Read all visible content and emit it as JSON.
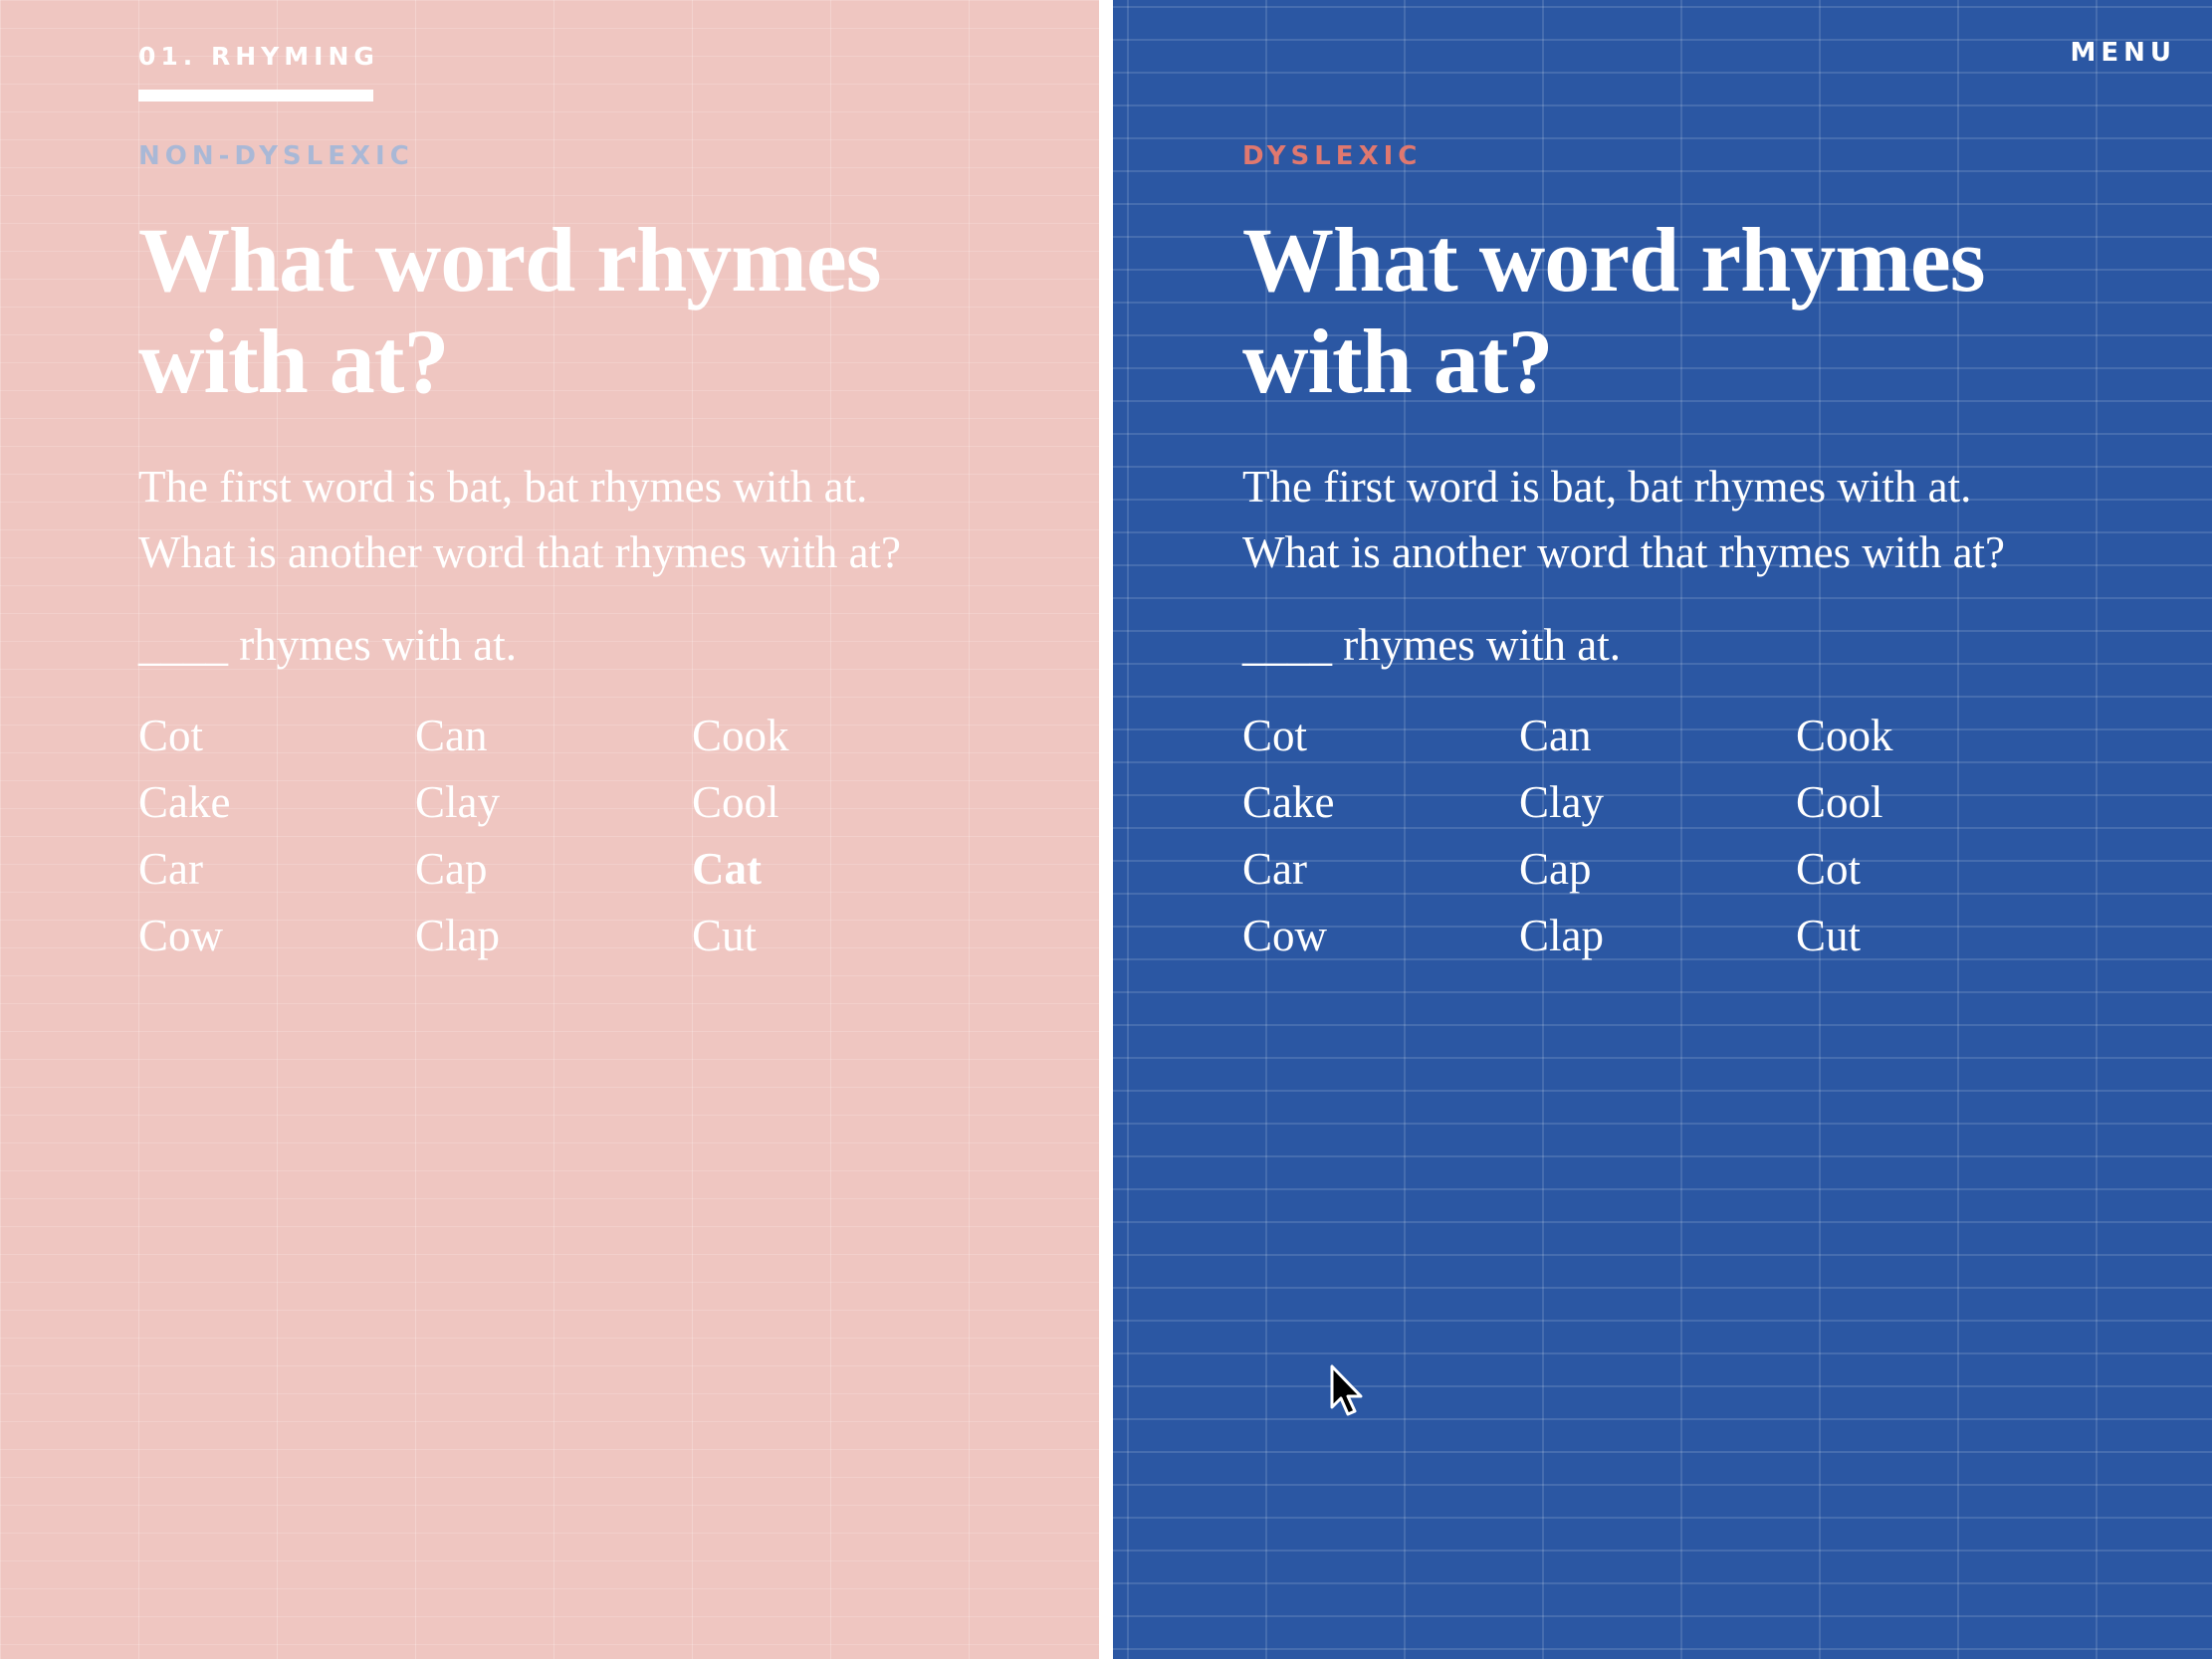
{
  "header": {
    "section_tag": "01. RHYMING",
    "menu_label": "MENU"
  },
  "colors": {
    "left_background": "#efc6c1",
    "right_background": "#2b57a3",
    "left_label": "#a9b8d6",
    "right_label": "#e0786f",
    "text": "#ffffff"
  },
  "left_panel": {
    "label": "NON-DYSLEXIC",
    "title": "What word rhymes with at?",
    "prompt_line1": "The first word is bat, bat rhymes with at.",
    "prompt_line2": "What is another word that rhymes with at?",
    "fill_blank": "____ rhymes with at.",
    "options": [
      "Cot",
      "Can",
      "Cook",
      "Cake",
      "Clay",
      "Cool",
      "Car",
      "Cap",
      "Cat",
      "Cow",
      "Clap",
      "Cut"
    ],
    "selected_option": "Cat"
  },
  "right_panel": {
    "label": "DYSLEXIC",
    "title": "What word rhymes with at?",
    "prompt_line1": "The first word is bat, bat rhymes with at.",
    "prompt_line2": "What is another word that rhymes with at?",
    "fill_blank": "____ rhymes with at.",
    "options": [
      "Cot",
      "Can",
      "Cook",
      "Cake",
      "Clay",
      "Cool",
      "Car",
      "Cap",
      "Cot",
      "Cow",
      "Clap",
      "Cut"
    ]
  },
  "icons": {
    "cursor": "mouse-pointer-icon"
  }
}
